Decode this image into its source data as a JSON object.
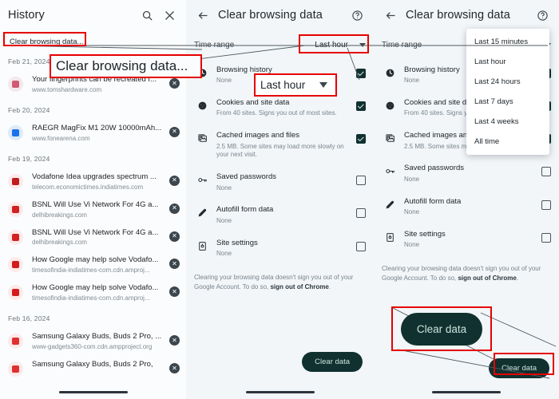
{
  "panels": {
    "history": {
      "title": "History",
      "icons": {
        "search": "search-icon",
        "close": "close-icon"
      },
      "chip": "Clear browsing data...",
      "groups": [
        {
          "date": "Feb 21, 2024",
          "items": [
            {
              "title": "Your fingerprints can be recreated f...",
              "url": "www.tomshardware.com",
              "favicon_color": "#f3e9ec",
              "favicon_mark": "#d05a74"
            }
          ]
        },
        {
          "date": "Feb 20, 2024",
          "items": [
            {
              "title": "RAEGR MagFix M1 20W 10000mAh...",
              "url": "www.fonearena.com",
              "favicon_color": "#dfeaf7",
              "favicon_mark": "#1a73e8"
            }
          ]
        },
        {
          "date": "Feb 19, 2024",
          "items": [
            {
              "title": "Vodafone Idea upgrades spectrum ...",
              "url": "telecom.economictimes.indiatimes.com",
              "favicon_color": "#fdeaea",
              "favicon_mark": "#c21b1b"
            },
            {
              "title": "BSNL Will Use Vi Network For 4G a...",
              "url": "delhibreakings.com",
              "favicon_color": "#fdeaea",
              "favicon_mark": "#d32020"
            },
            {
              "title": "BSNL Will Use Vi Network For 4G a...",
              "url": "delhibreakings.com",
              "favicon_color": "#fdeaea",
              "favicon_mark": "#d32020"
            },
            {
              "title": "How Google may help solve Vodafo...",
              "url": "timesofindia-indiatimes-com.cdn.amproj...",
              "favicon_color": "#fdeaea",
              "favicon_mark": "#d41b1b"
            },
            {
              "title": "How Google may help solve Vodafo...",
              "url": "timesofindia-indiatimes-com.cdn.amproj...",
              "favicon_color": "#fdeaea",
              "favicon_mark": "#d41b1b"
            }
          ]
        },
        {
          "date": "Feb 16, 2024",
          "items": [
            {
              "title": "Samsung Galaxy Buds, Buds 2 Pro, ...",
              "url": "www-gadgets360-com.cdn.ampproject.org",
              "favicon_color": "#fdeaea",
              "favicon_mark": "#e03030"
            },
            {
              "title": "Samsung Galaxy Buds, Buds 2 Pro,",
              "url": "",
              "favicon_color": "#fdeaea",
              "favicon_mark": "#e03030"
            }
          ]
        }
      ]
    },
    "clear_browsing_data": {
      "title": "Clear browsing data",
      "icons": {
        "back": "back-arrow-icon",
        "help": "help-circle-icon"
      },
      "time_range": {
        "label": "Time range",
        "value": "Last hour"
      },
      "options": [
        {
          "icon": "clock-icon",
          "title": "Browsing history",
          "sub": "None",
          "checked": true
        },
        {
          "icon": "cookie-icon",
          "title": "Cookies and site data",
          "sub": "From 40 sites. Signs you out of most sites.",
          "checked": true
        },
        {
          "icon": "image-icon",
          "title": "Cached images and files",
          "sub": "2.5 MB. Some sites may load more slowly on your next visit.",
          "checked": true
        },
        {
          "icon": "key-icon",
          "title": "Saved passwords",
          "sub": "None",
          "checked": false
        },
        {
          "icon": "pencil-icon",
          "title": "Autofill form data",
          "sub": "None",
          "checked": false
        },
        {
          "icon": "site-settings-icon",
          "title": "Site settings",
          "sub": "None",
          "checked": false
        }
      ],
      "footnote_part1": "Clearing your browsing data doesn't sign you out of your Google Account. To do so, ",
      "footnote_link": "sign out of Chrome",
      "footnote_part2": ".",
      "clear_button": "Clear data"
    },
    "dropdown_panel": {
      "title": "Clear browsing data",
      "icons": {
        "back": "back-arrow-icon",
        "help": "help-circle-icon"
      },
      "time_range_label": "Time range",
      "menu_options": [
        "Last 15 minutes",
        "Last hour",
        "Last 24 hours",
        "Last 7 days",
        "Last 4 weeks",
        "All time"
      ],
      "options": [
        {
          "icon": "clock-icon",
          "title": "Browsing history",
          "sub": "None",
          "checked": true
        },
        {
          "icon": "cookie-icon",
          "title": "Cookies and site da",
          "sub": "From 40 sites. Signs y sites.",
          "checked": true
        },
        {
          "icon": "image-icon",
          "title": "Cached images an",
          "sub": "2.5 MB. Some sites m on your next visit.",
          "checked": true
        },
        {
          "icon": "key-icon",
          "title": "Saved passwords",
          "sub": "None",
          "checked": false
        },
        {
          "icon": "pencil-icon",
          "title": "Autofill form data",
          "sub": "None",
          "checked": false
        },
        {
          "icon": "site-settings-icon",
          "title": "Site settings",
          "sub": "None",
          "checked": false
        }
      ],
      "footnote_part1": "Clearing your browsing data doesn't sign you out of your Google Account. To do so, ",
      "footnote_link": "sign out of Chrome",
      "footnote_part2": ".",
      "clear_button": "Clear data"
    }
  },
  "annotations": {
    "callout_clear_browsing_data": "Clear browsing data...",
    "callout_last_hour": "Last hour",
    "callout_clear_data": "Clear data"
  },
  "colors": {
    "accent_dark": "#10312f",
    "highlight_red": "#e60000",
    "page_bg": "#f2f6f9",
    "text_primary": "#1d2327",
    "text_secondary": "#7b858c"
  }
}
